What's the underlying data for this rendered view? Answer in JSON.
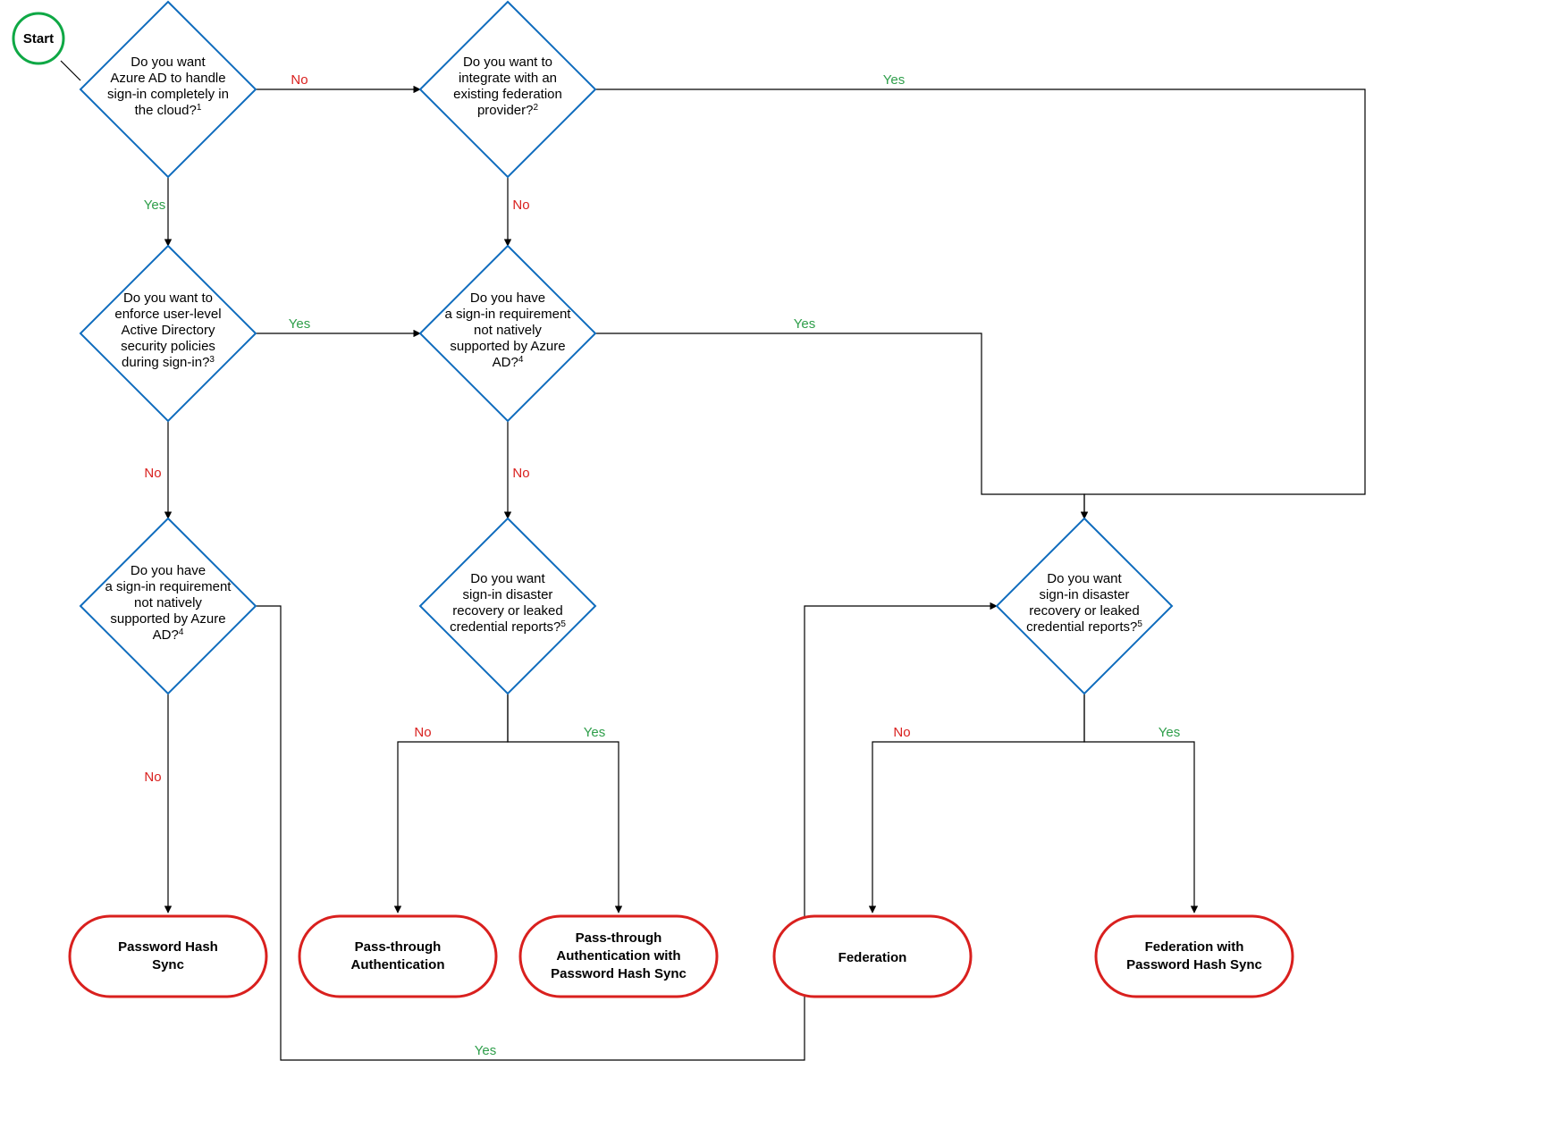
{
  "start": {
    "label": "Start"
  },
  "labels": {
    "yes": "Yes",
    "no": "No"
  },
  "colors": {
    "decision_stroke": "#0f6cbd",
    "terminator_stroke": "#d9201e",
    "start_stroke": "#0fa845",
    "arrow": "#000000"
  },
  "decisions": {
    "q1": {
      "lines": [
        "Do you want",
        "Azure AD to handle",
        "sign-in completely in",
        "the cloud?"
      ],
      "sup": "1"
    },
    "q2": {
      "lines": [
        "Do you want to",
        "integrate with an",
        "existing federation",
        "provider?"
      ],
      "sup": "2"
    },
    "q3": {
      "lines": [
        "Do you want to",
        "enforce user-level",
        "Active Directory",
        "security policies",
        "during sign-in?"
      ],
      "sup": "3"
    },
    "q4a": {
      "lines": [
        "Do you have",
        "a sign-in requirement",
        "not natively",
        "supported by Azure",
        "AD?"
      ],
      "sup": "4"
    },
    "q4b": {
      "lines": [
        "Do you have",
        "a sign-in requirement",
        "not natively",
        "supported by Azure",
        "AD?"
      ],
      "sup": "4"
    },
    "q5a": {
      "lines": [
        "Do you want",
        "sign-in disaster",
        "recovery or leaked",
        "credential reports?"
      ],
      "sup": "5"
    },
    "q5b": {
      "lines": [
        "Do you want",
        "sign-in disaster",
        "recovery or leaked",
        "credential reports?"
      ],
      "sup": "5"
    }
  },
  "terminators": {
    "phs": {
      "lines": [
        "Password Hash",
        "Sync"
      ]
    },
    "pta": {
      "lines": [
        "Pass-through",
        "Authentication"
      ]
    },
    "ptaps": {
      "lines": [
        "Pass-through",
        "Authentication with",
        "Password Hash Sync"
      ]
    },
    "fed": {
      "lines": [
        "Federation"
      ]
    },
    "fedps": {
      "lines": [
        "Federation with",
        "Password Hash Sync"
      ]
    }
  }
}
